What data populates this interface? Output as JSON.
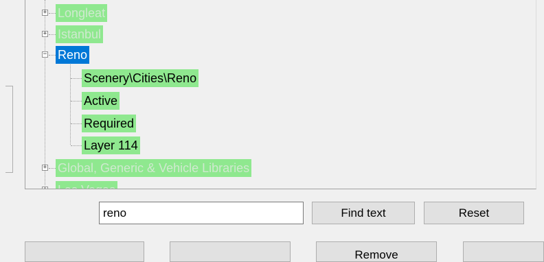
{
  "tree": {
    "nodes": [
      {
        "label": "Longleat",
        "expander": "+"
      },
      {
        "label": "Istanbul",
        "expander": "+"
      },
      {
        "label": "Reno",
        "expander": "−"
      },
      {
        "label": "Global, Generic & Vehicle Libraries",
        "expander": "+"
      },
      {
        "label": "Las Vegas",
        "expander": "+"
      }
    ],
    "reno_children": [
      {
        "label": "Scenery\\Cities\\Reno"
      },
      {
        "label": "Active"
      },
      {
        "label": "Required"
      },
      {
        "label": "Layer 114"
      }
    ]
  },
  "search": {
    "value": "reno",
    "find_label": "Find text",
    "reset_label": "Reset"
  },
  "bottom_buttons": [
    "",
    "",
    "Remove",
    ""
  ],
  "colors": {
    "highlight": "#8fe88f",
    "selected": "#0078d7"
  }
}
